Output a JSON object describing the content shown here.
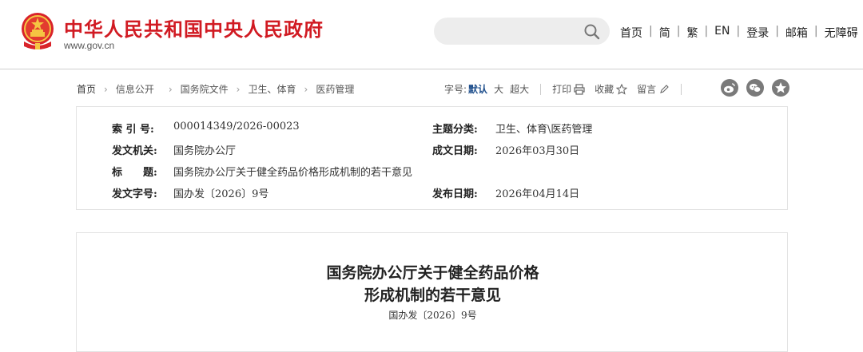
{
  "header": {
    "site_title": "中华人民共和国中央人民政府",
    "site_url": "www.gov.cn",
    "search": {
      "placeholder": "",
      "value": ""
    },
    "links": [
      "首页",
      "简",
      "繁",
      "EN",
      "登录",
      "邮箱",
      "无障碍"
    ],
    "colors": {
      "brand_red": "#d11a22",
      "search_bg": "#ededed"
    }
  },
  "breadcrumb": {
    "home": "首页",
    "items": [
      "信息公开",
      "国务院文件",
      "卫生、体育",
      "医药管理"
    ]
  },
  "toolbar": {
    "font_label": "字号:",
    "font_current": "默认",
    "font_options": [
      "大",
      "超大"
    ],
    "print": "打印",
    "favorite": "收藏",
    "comment": "留言"
  },
  "share": [
    "weibo-icon",
    "wechat-icon",
    "qzone-icon"
  ],
  "meta": {
    "index_no_label": "索 引 号:",
    "index_no": "000014349/2026-00023",
    "topic_label": "主题分类:",
    "topic": "卫生、体育\\医药管理",
    "issuer_label": "发文机关:",
    "issuer": "国务院办公厅",
    "written_label": "成文日期:",
    "written_date": "2026年03月30日",
    "title_label": "标　　题:",
    "title": "国务院办公厅关于健全药品价格形成机制的若干意见",
    "doc_no_label": "发文字号:",
    "doc_no": "国办发〔2026〕9号",
    "publish_label": "发布日期:",
    "publish_date": "2026年04月14日"
  },
  "document": {
    "title_line1": "国务院办公厅关于健全药品价格",
    "title_line2": "形成机制的若干意见",
    "doc_no": "国办发〔2026〕9号"
  }
}
